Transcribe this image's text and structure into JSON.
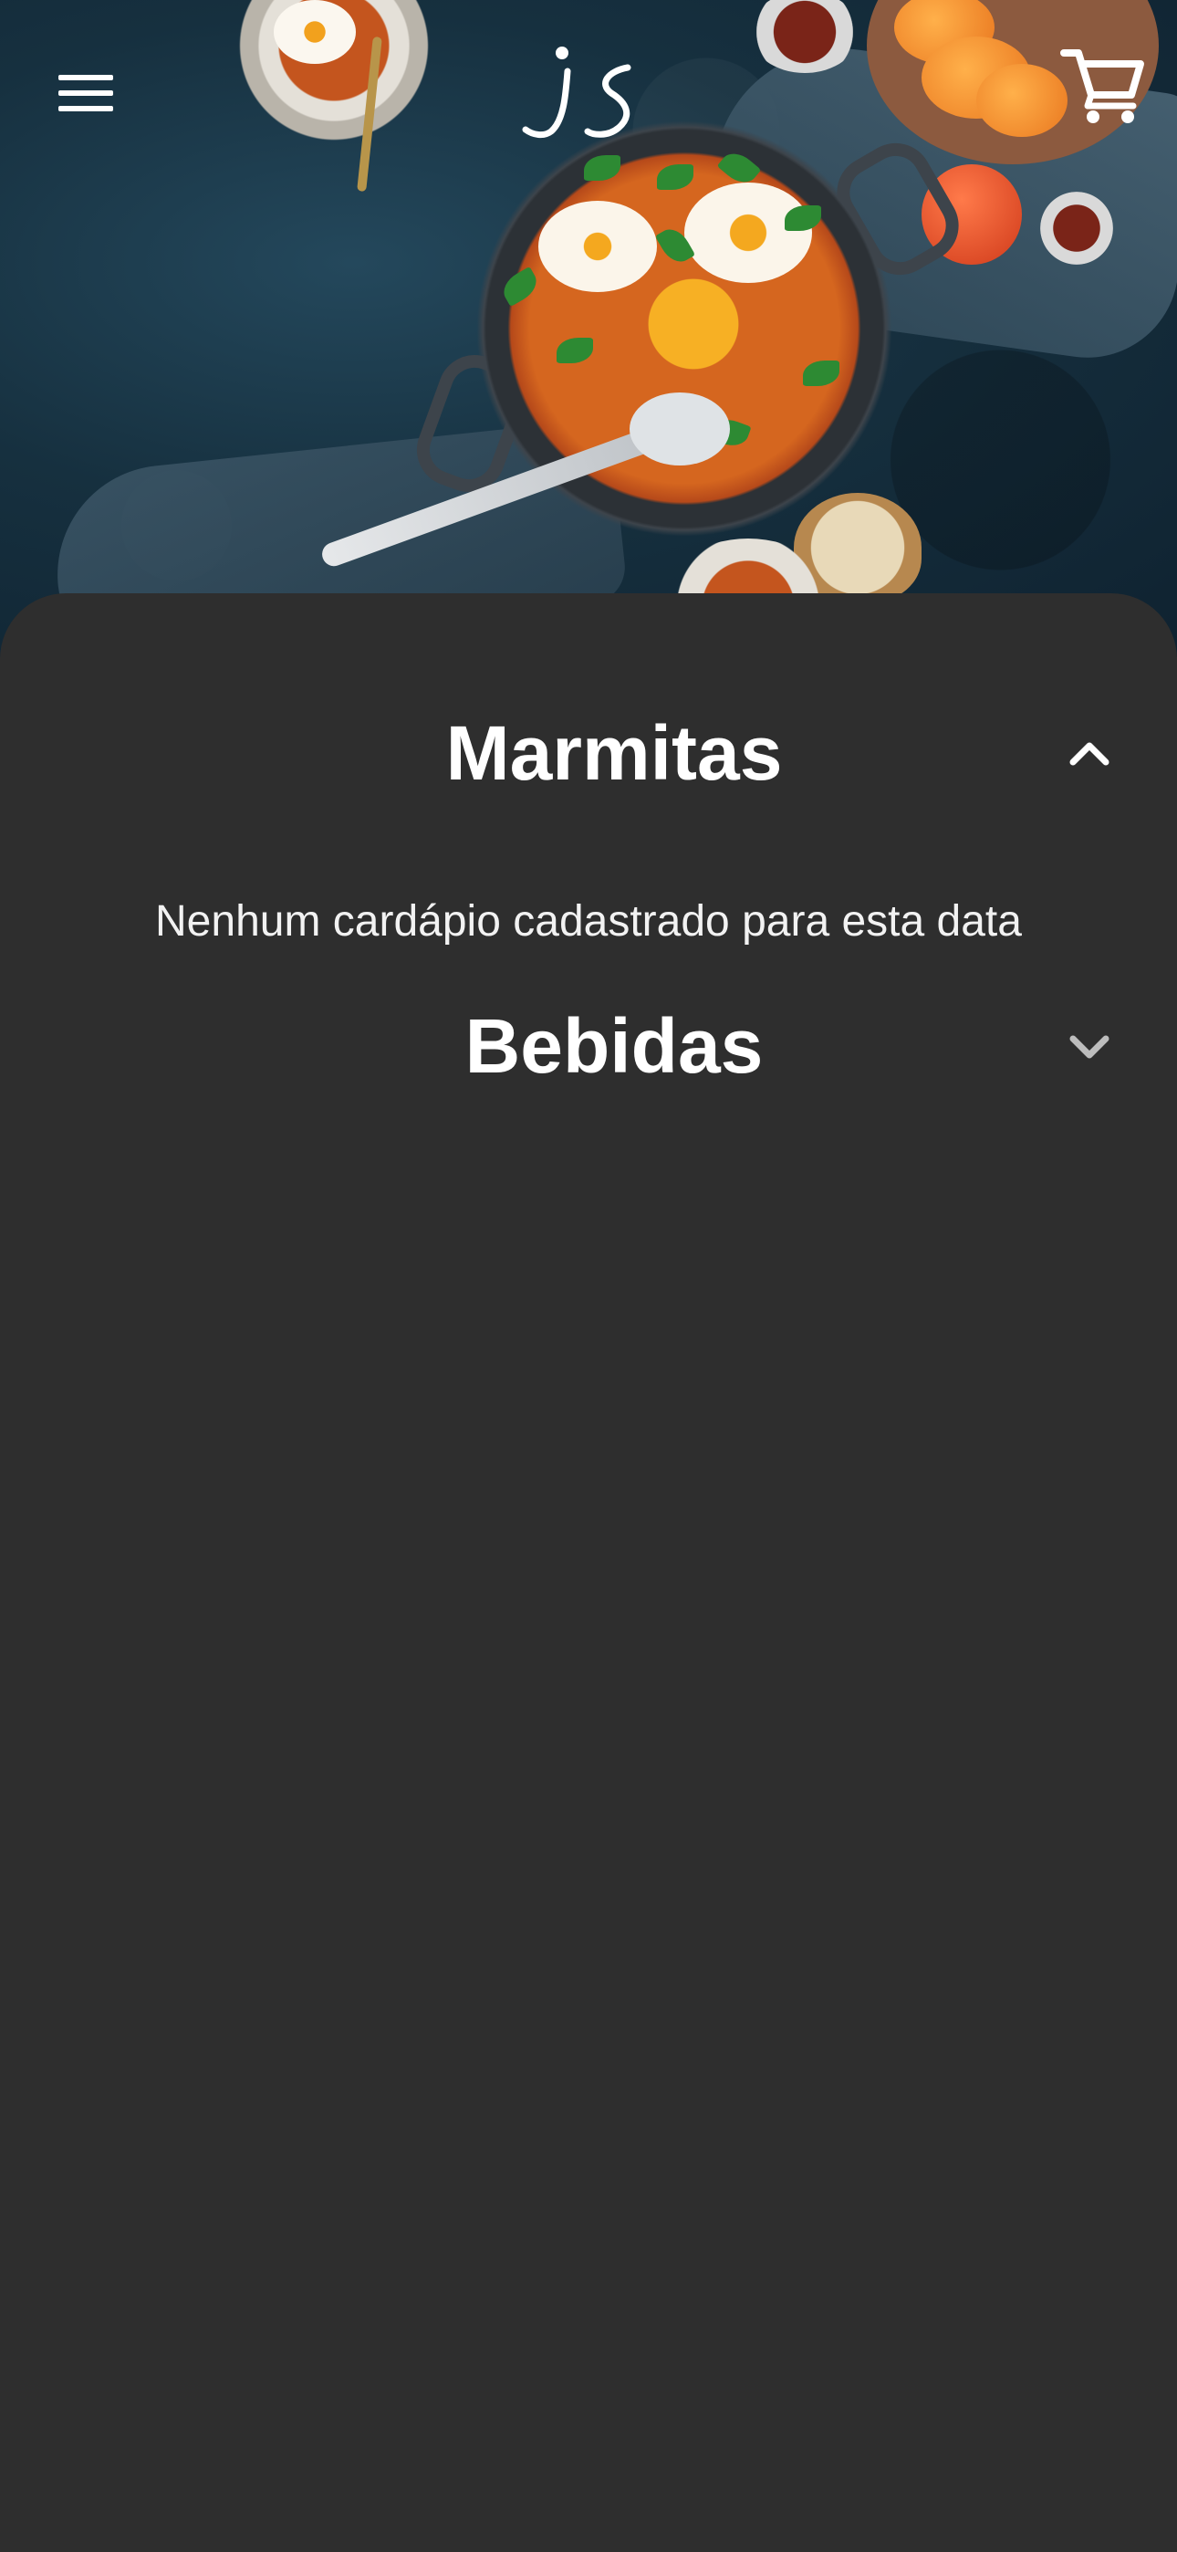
{
  "header": {
    "menu_icon": "hamburger-menu-icon",
    "logo_text": "js",
    "cart_icon": "shopping-cart-icon"
  },
  "hero": {
    "image_description_icon": "food-photo"
  },
  "sections": [
    {
      "title": "Marmitas",
      "expanded": true,
      "chevron_icon": "chevron-up-icon",
      "empty_message": "Nenhum cardápio cadastrado para esta data"
    },
    {
      "title": "Bebidas",
      "expanded": false,
      "chevron_icon": "chevron-down-icon"
    }
  ],
  "colors": {
    "background": "#2e2e2e",
    "text": "#ffffff",
    "chevron_collapsed": "#bdbdbd"
  }
}
